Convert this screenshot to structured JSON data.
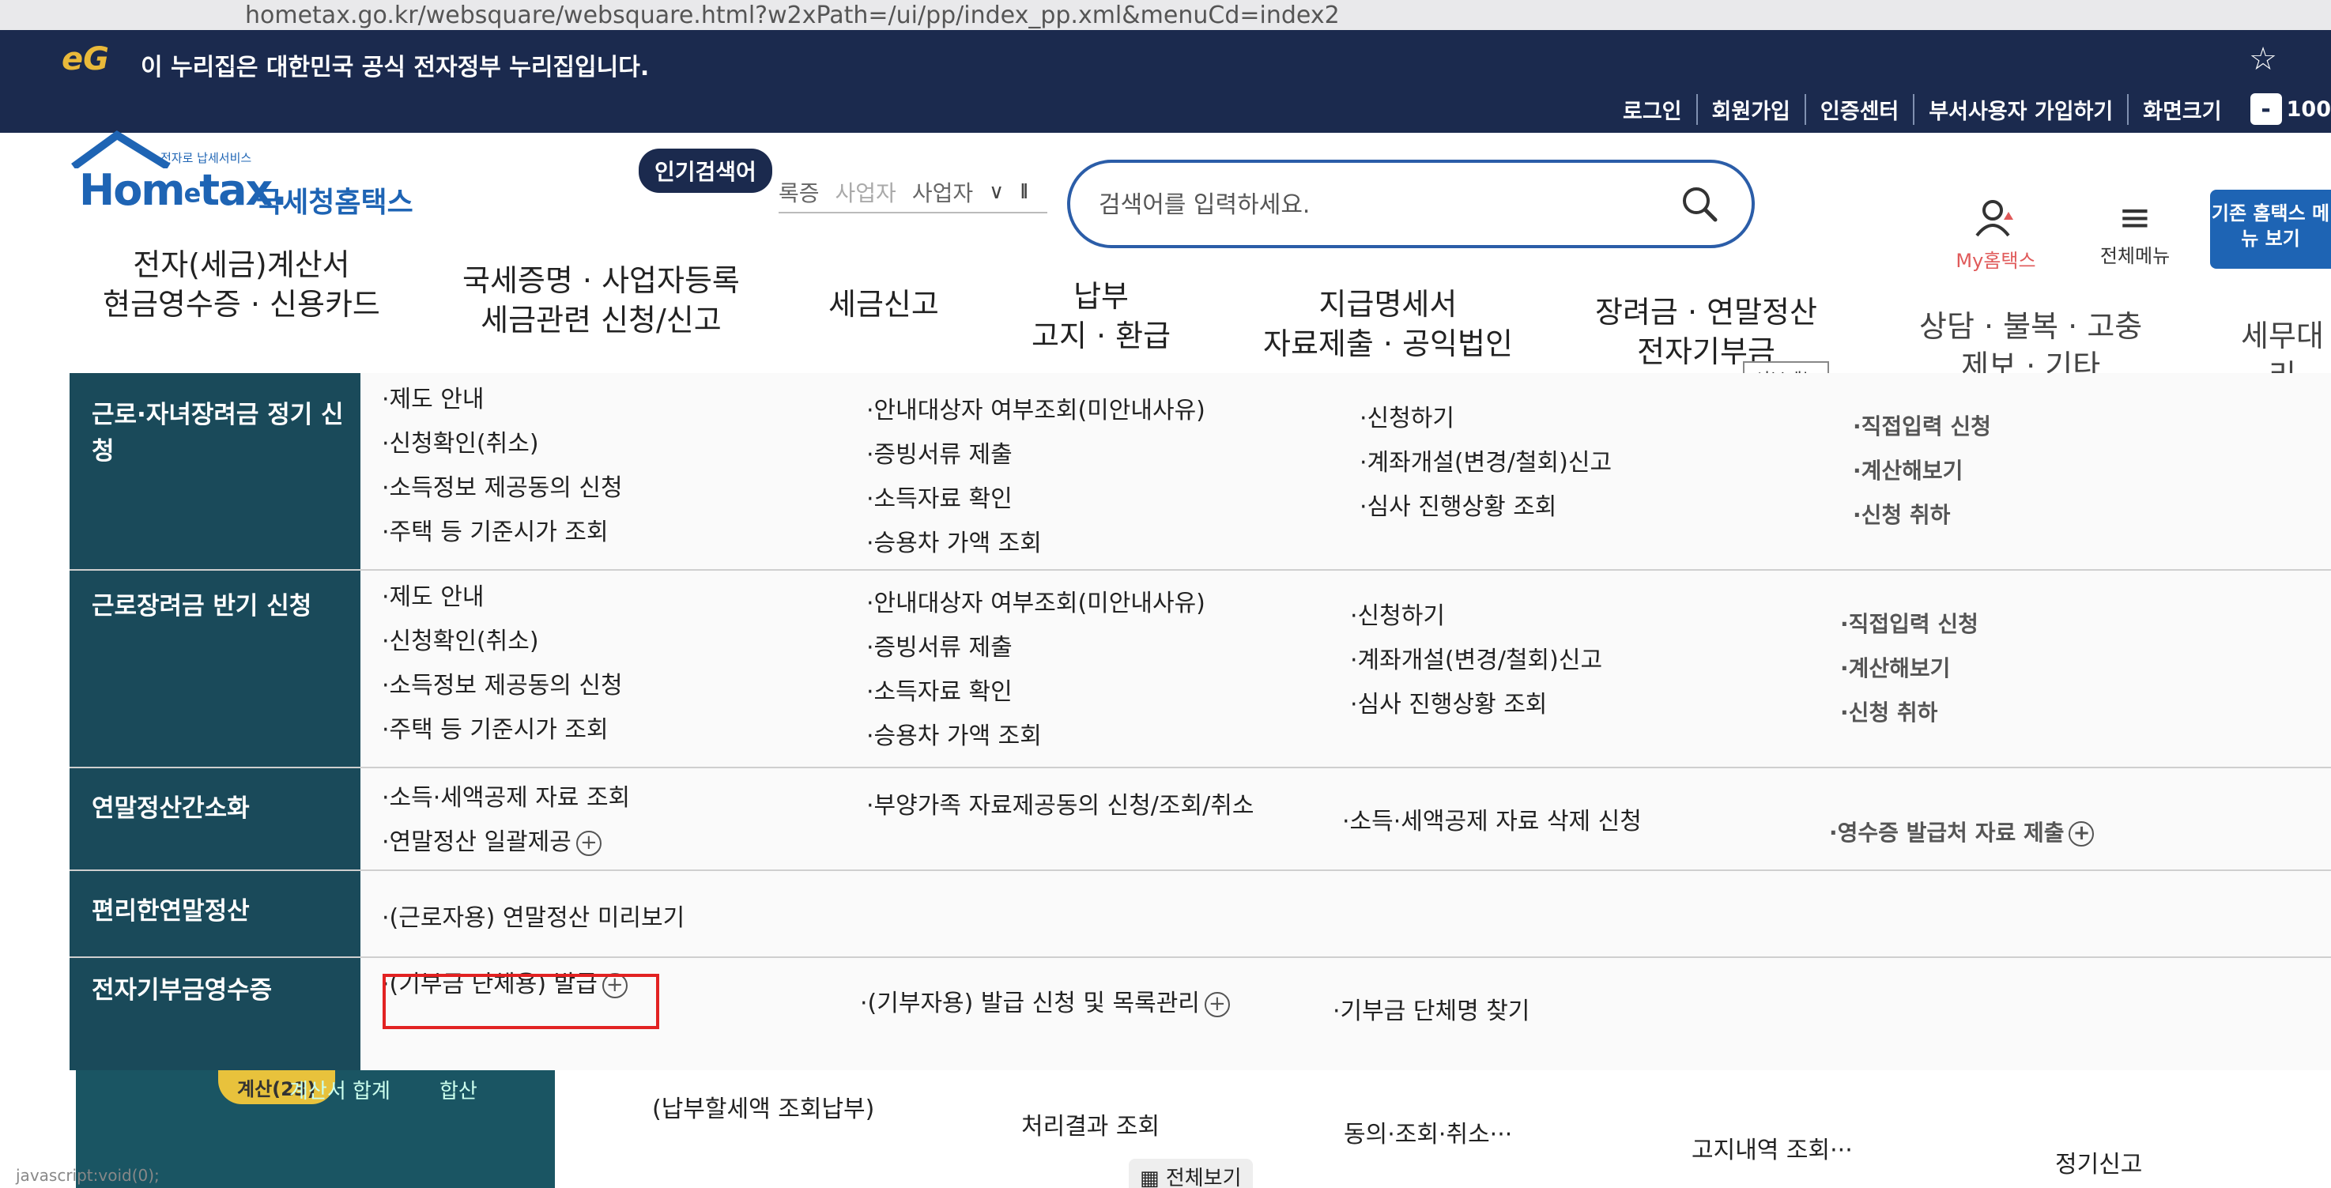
{
  "browser": {
    "url": "hometax.go.kr/websquare/websquare.html?w2xPath=/ui/pp/index_pp.xml&menuCd=index2"
  },
  "gov_banner": {
    "logo_text": "eG",
    "text": "이 누리집은 대한민국 공식 전자정부 누리집입니다."
  },
  "util": {
    "links": [
      "로그인",
      "회원가입",
      "인증센터",
      "부서사용자 가입하기",
      "화면크기"
    ],
    "zoom_minus": "-",
    "zoom_value": "100"
  },
  "logo": {
    "small_text": "전자로 납세서비스",
    "mark_a": "Hom",
    "mark_e": "e",
    "mark_b": "tax.",
    "name": "국세청홈택스"
  },
  "hot_search": {
    "badge": "인기검색어",
    "words": [
      "록증",
      "사업자",
      "사업자"
    ],
    "chevron": "∨",
    "pause": "II"
  },
  "search": {
    "placeholder": "검색어를 입력하세요."
  },
  "header_right": {
    "my_label": "My홈택스",
    "all_menu_label": "전체메뉴",
    "old_menu": "기존 홈택스 메뉴 보기"
  },
  "gnb": [
    "전자(세금)계산서\n현금영수증 · 신용카드",
    "국세증명 · 사업자등록\n세금관련 신청/신고",
    "세금신고",
    "납부\n고지 · 환급",
    "지급명세서\n자료제출 · 공익법인",
    "장려금 · 연말정산\n전자기부금",
    "상담 · 불복 · 고충\n제보 · 기타",
    "세무대리\n납세관리"
  ],
  "sub_tooltip": "서브메뉴",
  "mega": {
    "rows": [
      {
        "title": "근로·자녀장려금 정기 신청",
        "col1": [
          "·제도 안내",
          "·신청확인(취소)",
          "·소득정보 제공동의 신청",
          "·주택 등 기준시가 조회"
        ],
        "col2": [
          "·안내대상자 여부조회(미안내사유)",
          "·증빙서류 제출",
          "·소득자료 확인",
          "·승용차 가액 조회"
        ],
        "col3": [
          "·신청하기",
          "·계좌개설(변경/철회)신고",
          "·심사 진행상황 조회"
        ],
        "col4": [
          "·직접입력 신청",
          "·계산해보기",
          "·신청 취하"
        ]
      },
      {
        "title": "근로장려금 반기 신청",
        "col1": [
          "·제도 안내",
          "·신청확인(취소)",
          "·소득정보 제공동의 신청",
          "·주택 등 기준시가 조회"
        ],
        "col2": [
          "·안내대상자 여부조회(미안내사유)",
          "·증빙서류 제출",
          "·소득자료 확인",
          "·승용차 가액 조회"
        ],
        "col3": [
          "·신청하기",
          "·계좌개설(변경/철회)신고",
          "·심사 진행상황 조회"
        ],
        "col4": [
          "·직접입력 신청",
          "·계산해보기",
          "·신청 취하"
        ]
      },
      {
        "title": "연말정산간소화",
        "col1": [
          "·소득·세액공제 자료 조회",
          "·연말정산 일괄제공"
        ],
        "col2": [
          "·부양가족 자료제공동의 신청/조회/취소"
        ],
        "col3": [
          "·소득·세액공제 자료 삭제 신청"
        ],
        "col4": [
          "·영수증 발급처 자료 제출"
        ]
      },
      {
        "title": "편리한연말정산",
        "col1": [
          "·(근로자용) 연말정산 미리보기"
        ]
      },
      {
        "title": "전자기부금영수증",
        "col1": [
          "·(기부금 단체용) 발급"
        ],
        "col2": [
          "·(기부자용) 발급 신청 및 목록관리"
        ],
        "col3": [
          "·기부금 단체명 찾기"
        ]
      }
    ],
    "plus": "+"
  },
  "bottom": {
    "chip": "계산(23)",
    "tab2": "계산서 합계",
    "tab3": "합산",
    "items": [
      "(납부할세액 조회납부)",
      "처리결과 조회",
      "동의·조회·취소···",
      "고지내역 조회···",
      "정기신고"
    ],
    "view_all": "전체보기"
  },
  "status_text": "javascript:void(0);"
}
